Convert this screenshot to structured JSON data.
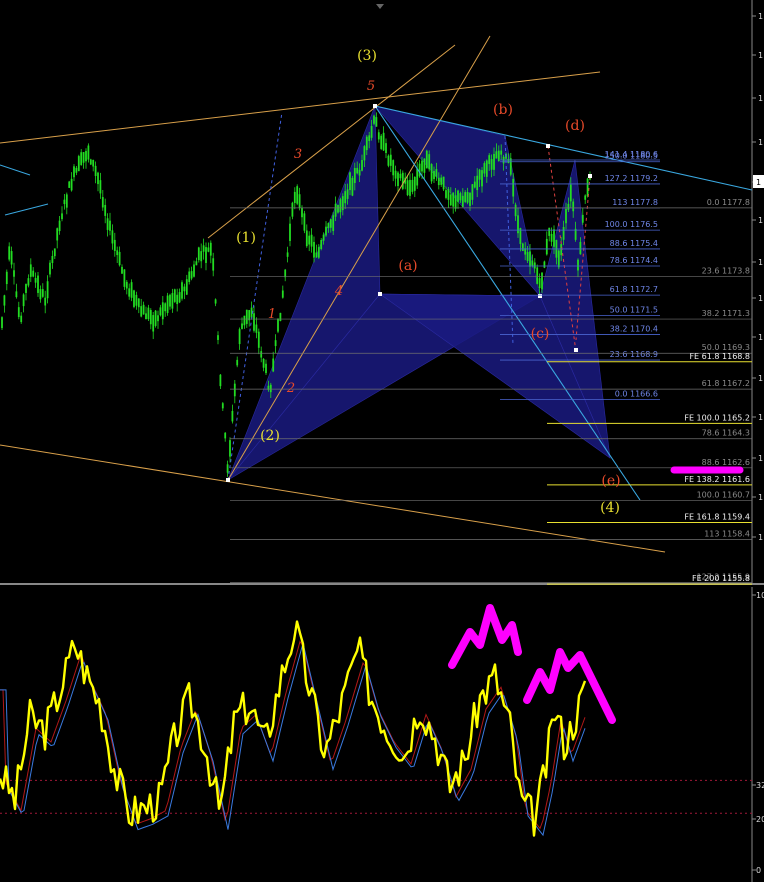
{
  "colors": {
    "background": "#000000",
    "candles": "#22dd22",
    "pattern_fill": "#1a1a80",
    "trend_line": "#d9a04a",
    "channel_line": "#3aa8e0",
    "fib_blue": "#4a64d0",
    "fib_gray": "#707070",
    "fe_yellow": "#e8e030",
    "wave_yellow": "#e8e030",
    "wave_red": "#e84a2a",
    "annotation_magenta": "#ff00ff",
    "osc_main": "#ffff00",
    "osc_signal_red": "#b01818",
    "osc_signal_blue": "#3a7ae0",
    "level_dotted": "#a01838"
  },
  "chart_data": [
    {
      "type": "candlestick",
      "name": "price",
      "y_axis_range": [
        1153.6,
        1183.7
      ],
      "price_levels": {
        "fib_retracement_blue": [
          {
            "label": "141.4 1180.6"
          },
          {
            "label": "150.0 1180.5"
          },
          {
            "label": "127.2 1179.2"
          },
          {
            "label": "113 1177.8"
          },
          {
            "label": "100.0 1176.5"
          },
          {
            "label": "88.6 1175.4"
          },
          {
            "label": "78.6 1174.4"
          },
          {
            "label": "61.8 1172.7"
          },
          {
            "label": "50.0 1171.5"
          },
          {
            "label": "38.2 1170.4"
          },
          {
            "label": "23.6 1168.9"
          },
          {
            "label": "0.0 1166.6"
          }
        ],
        "fib_retracement_gray": [
          {
            "label": "0.0 1177.8"
          },
          {
            "label": "23.6 1173.8"
          },
          {
            "label": "38.2 1171.3"
          },
          {
            "label": "50.0 1169.3"
          },
          {
            "label": "61.8 1167.2"
          },
          {
            "label": "78.6 1164.3"
          },
          {
            "label": "88.6 1162.6"
          },
          {
            "label": "100.0 1160.7"
          },
          {
            "label": "113 1158.4"
          },
          {
            "label": "127.2 1155.9"
          }
        ],
        "fib_expansion": [
          {
            "label": "FE 61.8 1168.8"
          },
          {
            "label": "FE 100.0 1165.2"
          },
          {
            "label": "FE 138.2 1161.6"
          },
          {
            "label": "FE 161.8 1159.4"
          },
          {
            "label": "FE 200 1155.8"
          }
        ]
      },
      "wave_labels_yellow": [
        "(1)",
        "(2)",
        "(3)",
        "(4)"
      ],
      "wave_labels_red_numbers": [
        "1",
        "2",
        "3",
        "4",
        "5"
      ],
      "wave_labels_red_letters": [
        "(a)",
        "(b)",
        "(c)",
        "(d)",
        "(e)"
      ],
      "current_price_marker": "1",
      "right_axis_ticks": [
        "1",
        "1",
        "1",
        "1",
        "1",
        "1",
        "1",
        "1",
        "1",
        "1",
        "1",
        "1",
        "1",
        "1"
      ]
    },
    {
      "type": "line",
      "name": "oscillator",
      "ylim": [
        0,
        100
      ],
      "right_axis_ticks": [
        "10",
        "32",
        "20",
        "0"
      ],
      "levels": [
        32,
        20
      ],
      "annotation": "magenta double M-shape drawn over recent peaks"
    }
  ]
}
